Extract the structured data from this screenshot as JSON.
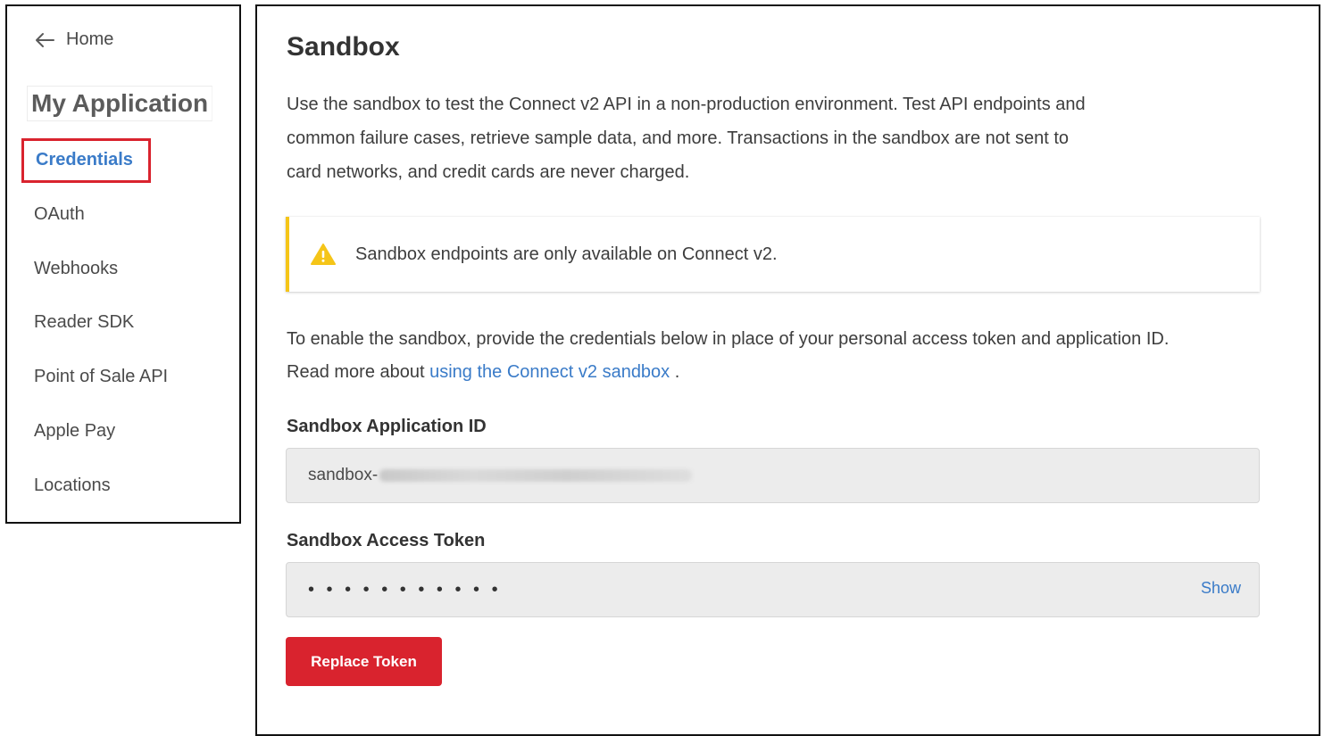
{
  "sidebar": {
    "home_label": "Home",
    "app_title": "My Application",
    "items": [
      {
        "label": "Credentials",
        "active": true
      },
      {
        "label": "OAuth"
      },
      {
        "label": "Webhooks"
      },
      {
        "label": "Reader SDK"
      },
      {
        "label": "Point of Sale API"
      },
      {
        "label": "Apple Pay"
      },
      {
        "label": "Locations"
      }
    ]
  },
  "main": {
    "title": "Sandbox",
    "description": "Use the sandbox to test the Connect v2 API in a non-production environment. Test API endpoints and common failure cases, retrieve sample data, and more. Transactions in the sandbox are not sent to card networks, and credit cards are never charged.",
    "notice": "Sandbox endpoints are only available on Connect v2.",
    "enable_text": "To enable the sandbox, provide the credentials below in place of your personal access token and application ID. Read more about",
    "enable_link": "using the Connect v2 sandbox",
    "enable_suffix": " .",
    "app_id_label": "Sandbox Application ID",
    "app_id_value": "sandbox-",
    "token_label": "Sandbox Access Token",
    "token_mask": "• • • • • • • • • • •",
    "show_label": "Show",
    "replace_button": "Replace Token"
  },
  "colors": {
    "accent_link": "#3a7bc8",
    "danger": "#d9232e",
    "warning": "#f5c518"
  }
}
